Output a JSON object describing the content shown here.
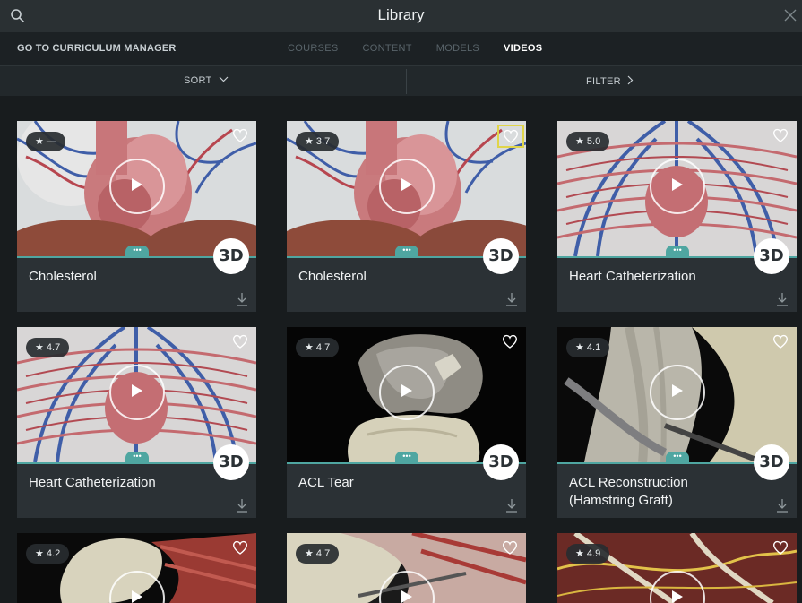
{
  "header": {
    "title": "Library",
    "search_icon": "search-icon",
    "close_icon": "close-icon"
  },
  "nav": {
    "curriculum_link": "GO TO CURRICULUM MANAGER",
    "tabs": [
      {
        "label": "COURSES",
        "active": false
      },
      {
        "label": "CONTENT",
        "active": false
      },
      {
        "label": "MODELS",
        "active": false
      },
      {
        "label": "VIDEOS",
        "active": true
      }
    ]
  },
  "toolbar": {
    "sort_label": "SORT",
    "filter_label": "FILTER"
  },
  "colors": {
    "accent": "#4fa6a1",
    "selected_outline": "#e0d54a",
    "background": "#181c1e"
  },
  "cards": [
    {
      "title": "Cholesterol",
      "rating": "★ —",
      "badge": "3D",
      "thumb": "heart"
    },
    {
      "title": "Cholesterol",
      "rating": "★ 3.7",
      "badge": "3D",
      "thumb": "heart",
      "favorite_selected": true
    },
    {
      "title": "Heart Catheterization",
      "rating": "★ 5.0",
      "badge": "3D",
      "thumb": "vessels"
    },
    {
      "title": "Heart Catheterization",
      "rating": "★ 4.7",
      "badge": "3D",
      "thumb": "vessels"
    },
    {
      "title": "ACL Tear",
      "rating": "★ 4.7",
      "badge": "3D",
      "thumb": "knee"
    },
    {
      "title": "ACL Reconstruction (Hamstring Graft)",
      "rating": "★ 4.1",
      "badge": "3D",
      "thumb": "graft"
    },
    {
      "title": "",
      "rating": "★ 4.2",
      "badge": "",
      "thumb": "shoulder"
    },
    {
      "title": "",
      "rating": "★ 4.7",
      "badge": "",
      "thumb": "joint"
    },
    {
      "title": "",
      "rating": "★ 4.9",
      "badge": "",
      "thumb": "nerves"
    }
  ]
}
